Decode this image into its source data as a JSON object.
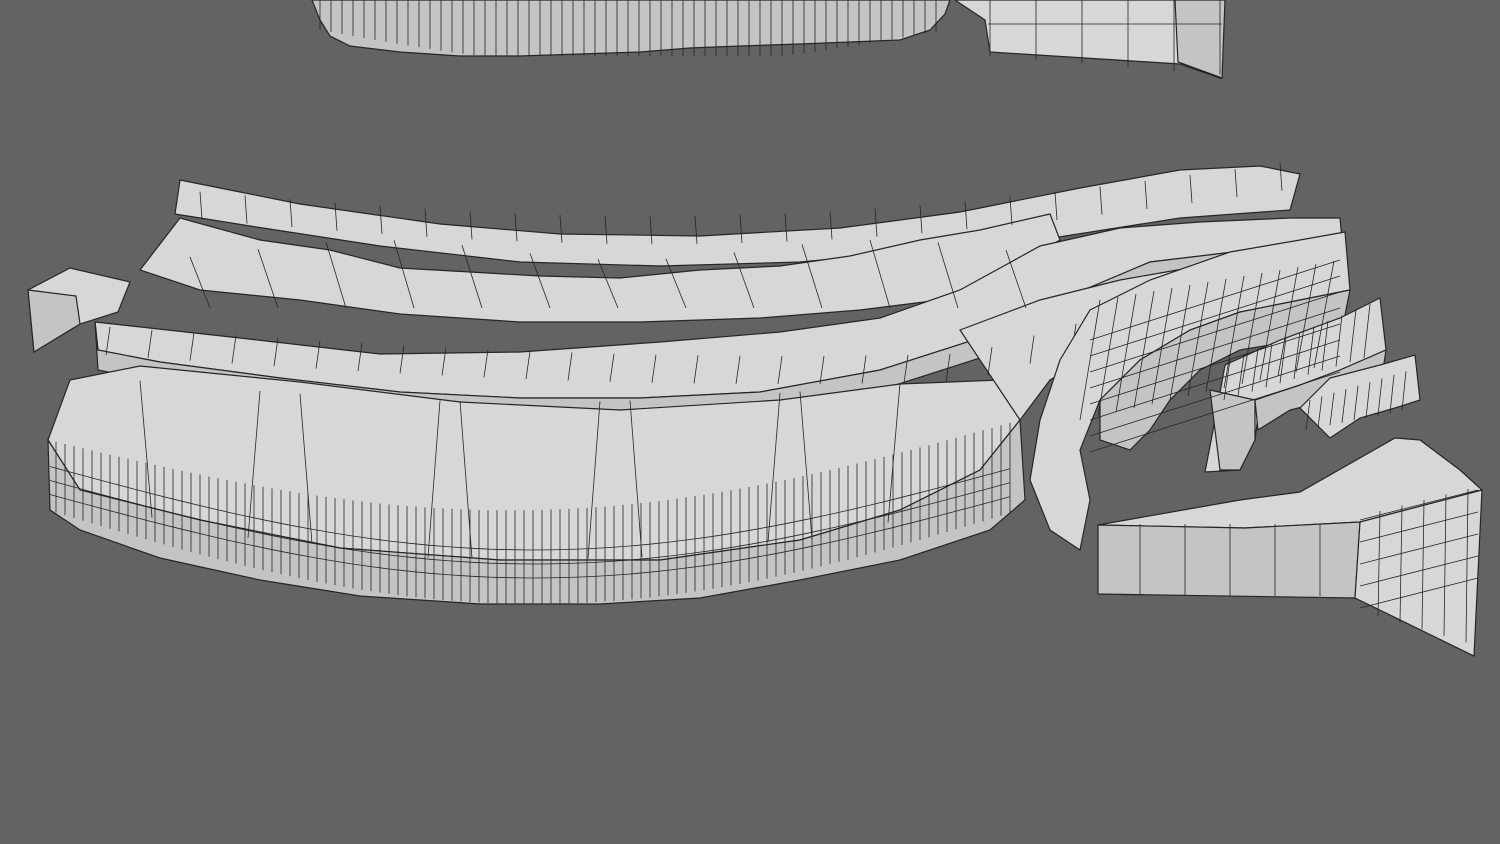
{
  "viewport": {
    "background": "#636363",
    "mesh_fill": "#d7d7d7",
    "mesh_side_fill": "#c4c4c4",
    "mesh_dark_fill": "#a8a8a8",
    "wire_color": "#262626"
  },
  "scene": {
    "style": "untextured clay render with wireframe overlay",
    "objects": [
      "upper-mesh-fragment",
      "winding-stair-ramp-mesh",
      "curved-bench-pods",
      "block-base"
    ]
  }
}
